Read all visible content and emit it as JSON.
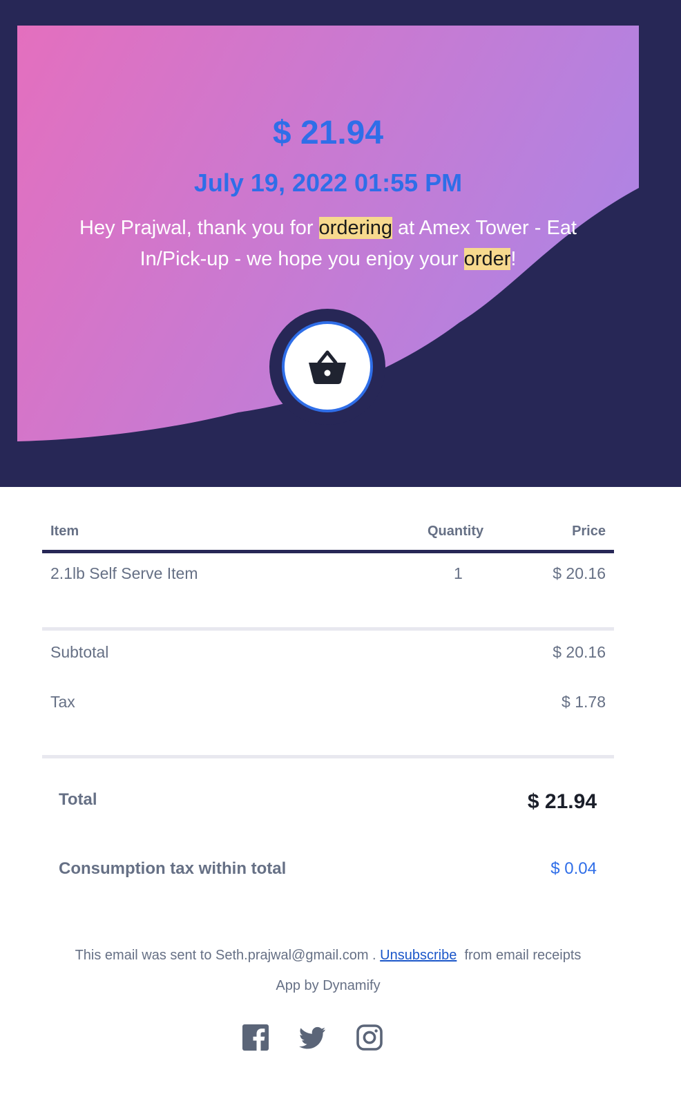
{
  "hero": {
    "amount": "$ 21.94",
    "datetime": "July 19, 2022 01:55 PM",
    "message": {
      "part1": "Hey Prajwal, thank you for ",
      "highlight1": "ordering",
      "part2": " at Amex Tower - Eat In/Pick-up - we hope you enjoy your ",
      "highlight2": "order",
      "part3": "!"
    },
    "icon": "shopping-basket-icon"
  },
  "table": {
    "headers": {
      "item": "Item",
      "quantity": "Quantity",
      "price": "Price"
    },
    "rows": [
      {
        "item": "2.1lb Self Serve Item",
        "quantity": "1",
        "price": "$ 20.16"
      }
    ]
  },
  "summary": {
    "subtotal_label": "Subtotal",
    "subtotal_value": "$ 20.16",
    "tax_label": "Tax",
    "tax_value": "$ 1.78"
  },
  "totals": {
    "total_label": "Total",
    "total_value": "$ 21.94",
    "consumption_label": "Consumption tax within total",
    "consumption_value": "$ 0.04"
  },
  "footer": {
    "sent_prefix": "This email was sent to Seth.prajwal@gmail.com . ",
    "unsubscribe": "Unsubscribe",
    "sent_suffix": "  from email receipts",
    "app_by": "App by Dynamify",
    "social": [
      "facebook-icon",
      "twitter-icon",
      "instagram-icon"
    ]
  },
  "colors": {
    "header_bg": "#272756",
    "gradient_start": "#e46fbe",
    "gradient_end": "#b183e2",
    "accent": "#2f6ee8",
    "highlight": "#f7d98e"
  }
}
